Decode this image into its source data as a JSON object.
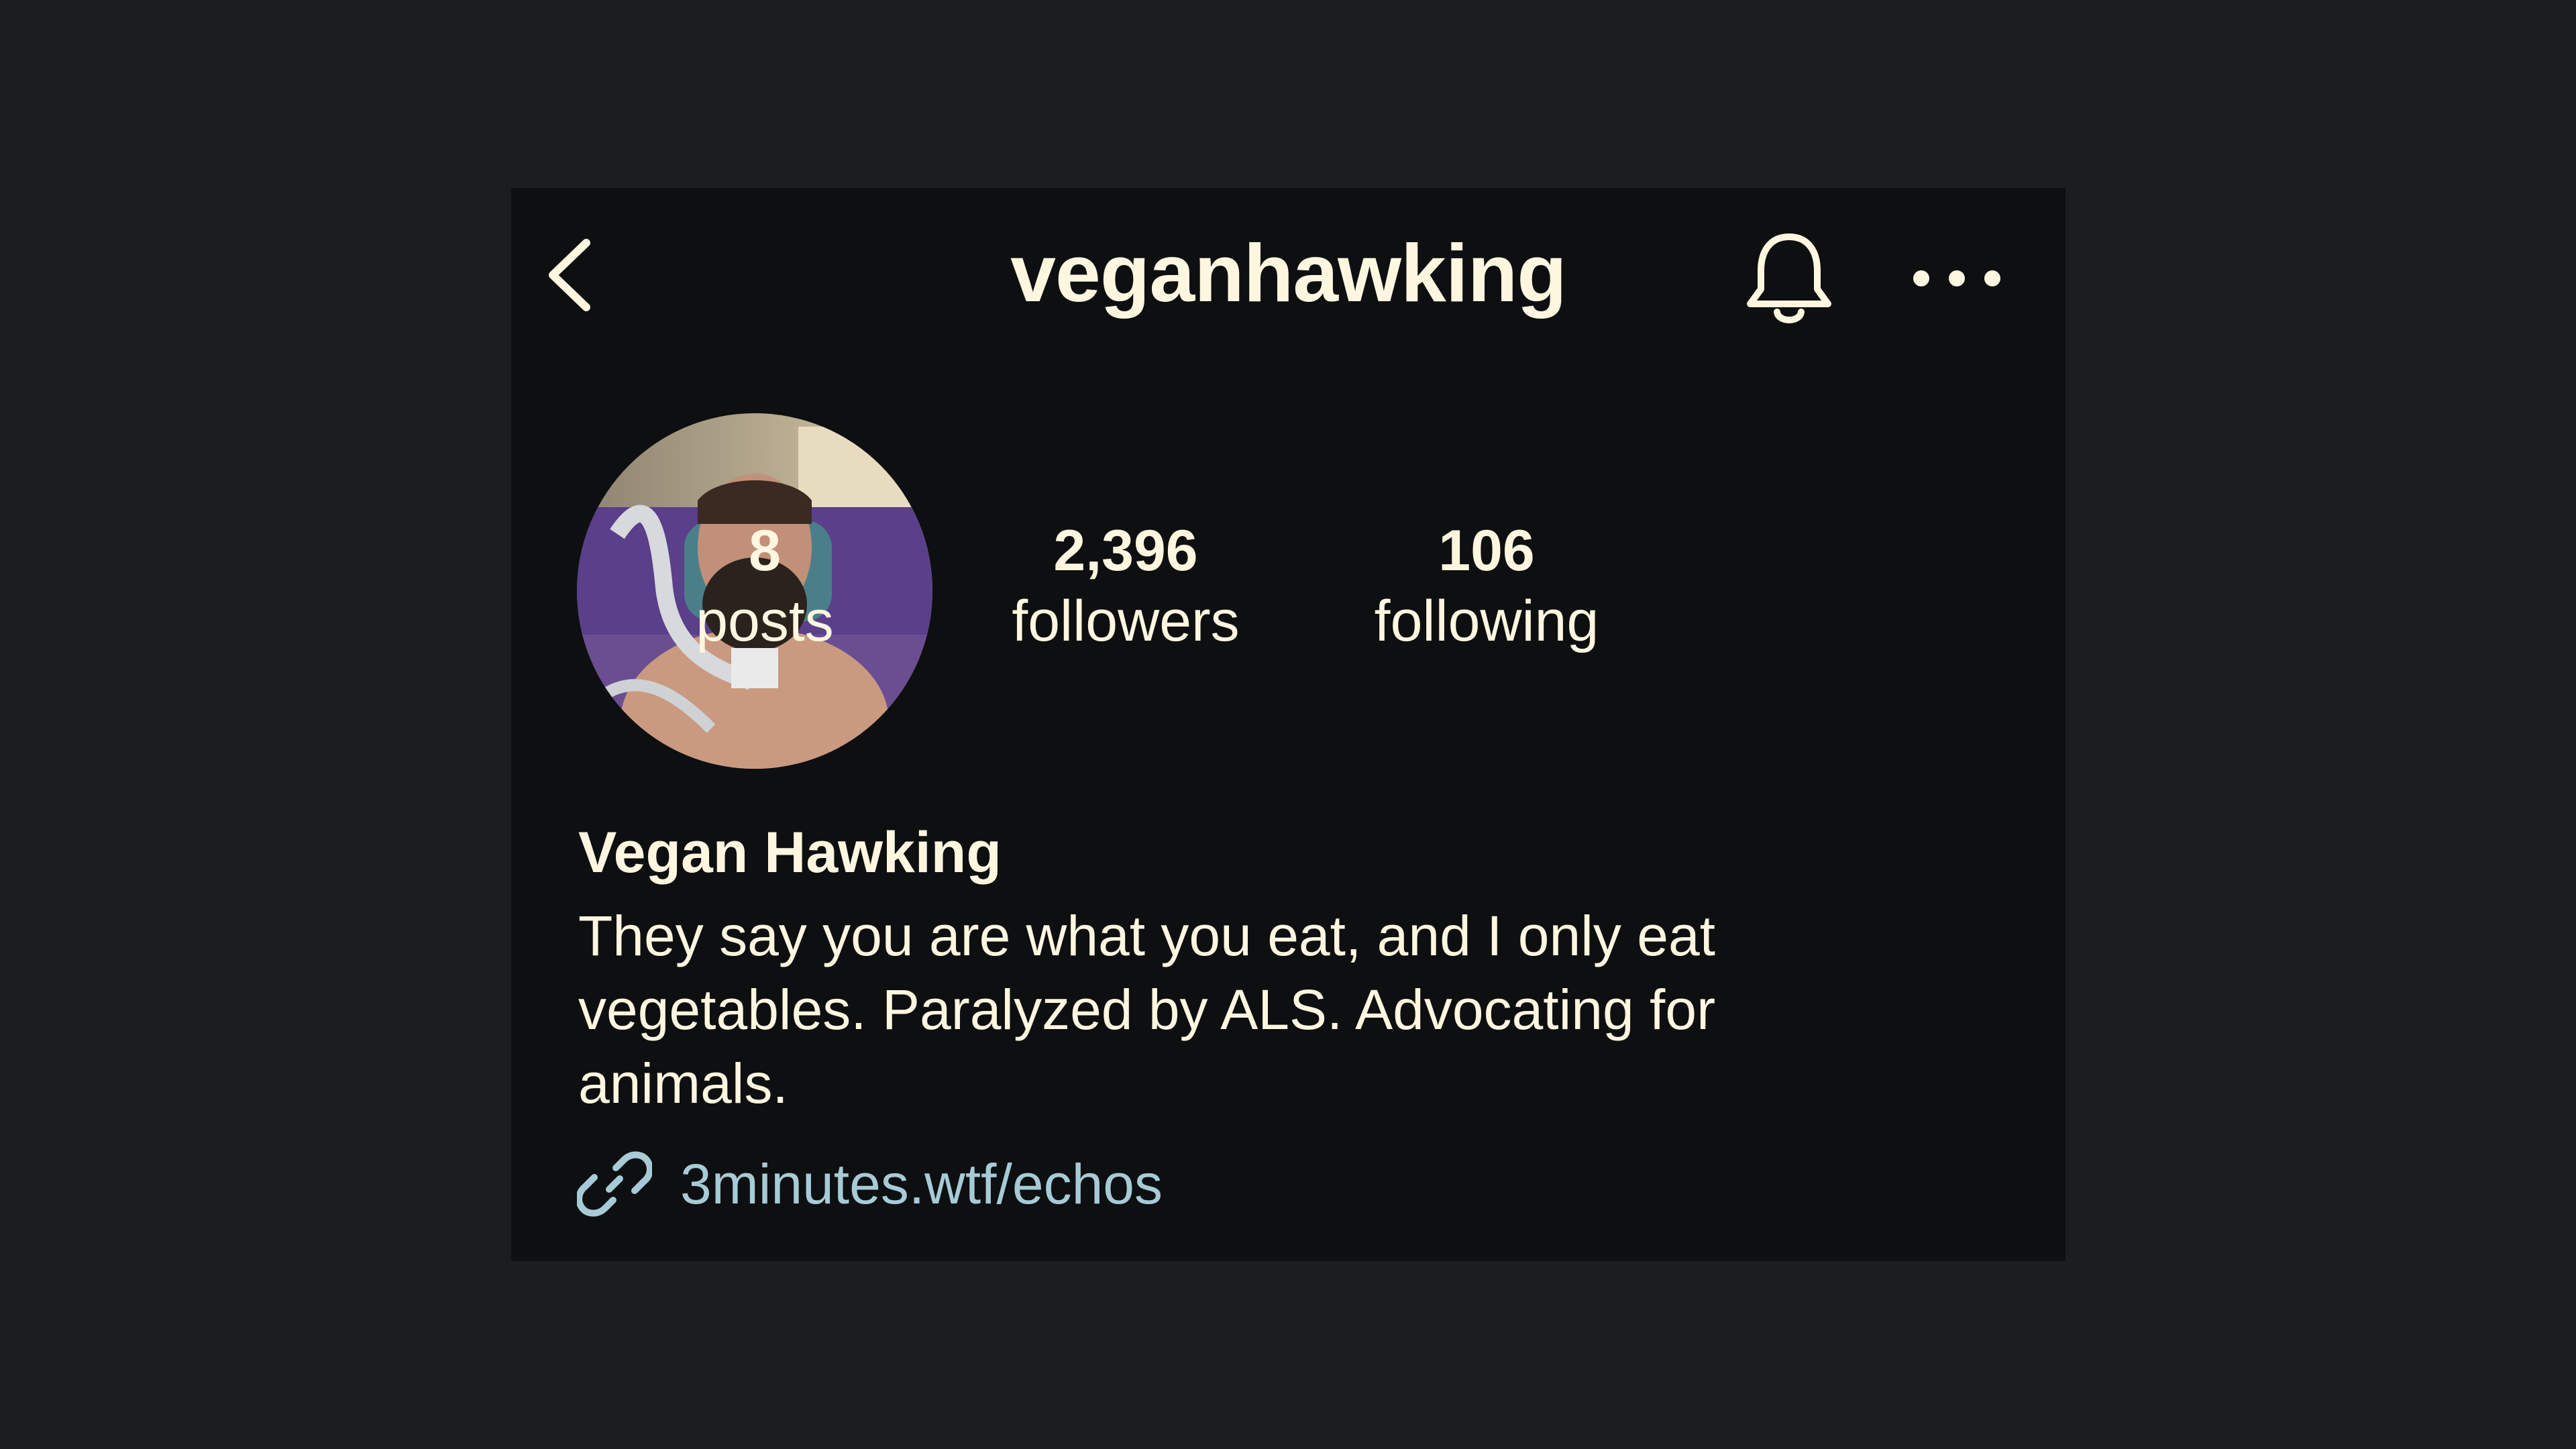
{
  "header": {
    "username": "veganhawking",
    "back_icon": "chevron-left-icon",
    "bell_icon": "bell-icon",
    "more_icon": "more-dots-icon"
  },
  "stats": [
    {
      "value": "8",
      "label": "posts"
    },
    {
      "value": "2,396",
      "label": "followers"
    },
    {
      "value": "106",
      "label": "following"
    }
  ],
  "profile": {
    "display_name": "Vegan Hawking",
    "bio": "They say you are what you eat, and I only eat vegetables. Paralyzed by ALS. Advocating for animals.",
    "link": "3minutes.wtf/echos",
    "link_icon": "link-icon"
  },
  "colors": {
    "page_background": "#1c1d20",
    "card_background": "#0e0f11",
    "text": "#fff6e0",
    "link": "#a6cbd6"
  }
}
